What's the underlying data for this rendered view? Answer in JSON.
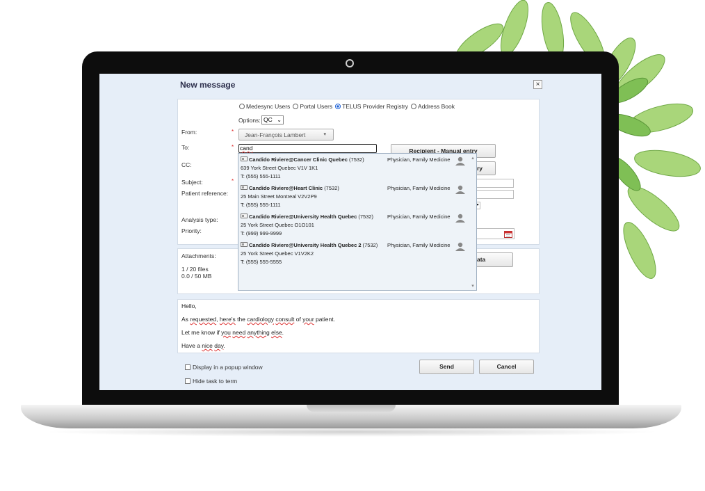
{
  "dialog": {
    "title": "New message",
    "close_icon": "×"
  },
  "recipient_types": [
    {
      "label": "Medesync Users",
      "selected": false
    },
    {
      "label": "Portal Users",
      "selected": false
    },
    {
      "label": "TELUS Provider Registry",
      "selected": true
    },
    {
      "label": "Address Book",
      "selected": false
    }
  ],
  "options": {
    "label": "Options:",
    "value": "QC"
  },
  "from": {
    "label": "From:",
    "value": "Jean-François Lambert"
  },
  "to": {
    "label": "To:",
    "value": "cand"
  },
  "cc": {
    "label": "CC:"
  },
  "subject": {
    "label": "Subject:"
  },
  "patient_reference": {
    "label": "Patient reference:"
  },
  "analysis_type": {
    "label": "Analysis type:"
  },
  "priority": {
    "label": "Priority:"
  },
  "required_marker": "*",
  "buttons": {
    "manual_entry": "Recipient - Manual entry",
    "registry_partial": "ry",
    "data_partial": "ata",
    "send": "Send",
    "cancel": "Cancel"
  },
  "attachments": {
    "label": "Attachments:",
    "files": "1 / 20 files",
    "size": "0.0 / 50 MB"
  },
  "suggestions": [
    {
      "name": "Candido Riviere@Cancer Clinic Quebec",
      "code": "(7532)",
      "address": "639 York Street Quebec V1V 1K1",
      "phone": "T: (555) 555-1111",
      "specialty": "Physician, Family Medicine"
    },
    {
      "name": "Candido Riviere@Heart Clinic",
      "code": "(7532)",
      "address": "25 Main Street Montreal V2V2P9",
      "phone": "T: (555) 555-1111",
      "specialty": "Physician, Family Medicine"
    },
    {
      "name": "Candido Riviere@University Health Quebec",
      "code": "(7532)",
      "address": "25 York Street Quebec O1O101",
      "phone": "T: (999) 999-9999",
      "specialty": "Physician, Family Medicine"
    },
    {
      "name": "Candido Riviere@University Health Quebec 2",
      "code": "(7532)",
      "address": "25 York Street Quebec V1V2K2",
      "phone": "T: (555) 555-5555",
      "specialty": "Physician, Family Medicine"
    }
  ],
  "message": {
    "line1": "Hello,",
    "line2": [
      "As ",
      "requested",
      ", ",
      "here's",
      " the ",
      "cardiology",
      " ",
      "consult",
      " of ",
      "your",
      " patient."
    ],
    "line3": [
      "Let me know if ",
      "you",
      " ",
      "need",
      " ",
      "anything",
      " ",
      "else",
      "."
    ],
    "line4": [
      "Have a ",
      "nice",
      " ",
      "day",
      "."
    ]
  },
  "checkboxes": {
    "popup": "Display in a popup window",
    "hide_task": "Hide task to term"
  },
  "icons": {
    "close": "close-icon",
    "person": "person-icon",
    "card": "contact-card-icon",
    "calendar": "calendar-icon",
    "dropdown": "chevron-down-icon"
  },
  "colors": {
    "screen_bg": "#e6eef8",
    "title": "#2b2d4a",
    "required": "#dd2222",
    "radio_selected": "#1a5fd6"
  }
}
